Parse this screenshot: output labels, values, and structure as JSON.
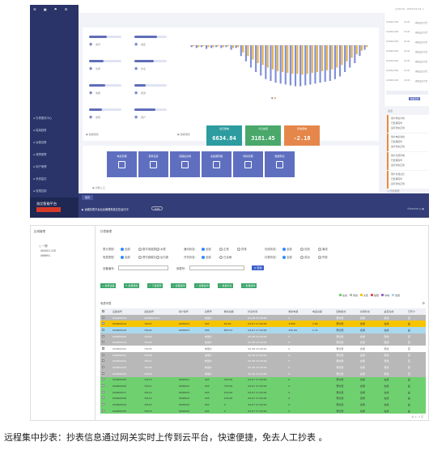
{
  "caption": "远程集中抄表：抄表信息通过网关实时上传到云平台，快速便捷，免去人工抄表 。",
  "top": {
    "header_right": "◷ 09:23 · 2019-04-14 ▢",
    "sidebar": [
      "抄表服务中心",
      "能量趋势",
      "远程设置",
      "故障报警",
      "用户管理",
      "系统监控",
      "权限控制"
    ],
    "brand": "洛比智能平台",
    "stats": [
      {
        "label": "通讯",
        "level": 0.55
      },
      {
        "label": "电压",
        "level": 0.7
      },
      {
        "label": "功率",
        "level": 0.45
      },
      {
        "label": "抄表",
        "level": 0.6
      },
      {
        "label": "电量",
        "level": 0.5
      },
      {
        "label": "费用",
        "level": 0.35
      },
      {
        "label": "告警",
        "level": 0.4
      },
      {
        "label": "用户",
        "level": 0.65
      }
    ],
    "stats_link": "数据报告",
    "chart_link": "数据报告",
    "meters": [
      {
        "title": "当日用电",
        "value": "6634.84",
        "color": "#2d9ca0"
      },
      {
        "title": "今日充值",
        "value": "3181.45",
        "color": "#4aa86b"
      },
      {
        "title": "异常用电",
        "value": "-2.18",
        "color": "#e5874a"
      }
    ],
    "chart_data": {
      "type": "bar",
      "categories": [
        "1",
        "2",
        "3",
        "4",
        "5",
        "6",
        "7",
        "8",
        "9",
        "10",
        "11",
        "12",
        "13",
        "14",
        "15",
        "16",
        "17",
        "18",
        "19",
        "20",
        "21",
        "22",
        "23",
        "24",
        "25",
        "26",
        "27",
        "28",
        "29",
        "30",
        "31",
        "32",
        "33",
        "34",
        "35",
        "36"
      ],
      "series": [
        {
          "values": [
            -2,
            -3,
            -2,
            -4,
            -3,
            -2,
            -3,
            -2,
            -5,
            -3,
            -12,
            -18,
            -25,
            -30,
            -34,
            -38,
            -40,
            -42,
            -43,
            -44,
            -45,
            -46,
            -46,
            -45,
            -44,
            -43,
            -42,
            -41,
            -40,
            -38,
            -35,
            -30,
            -25,
            -20,
            -12,
            -5
          ]
        },
        {
          "values": [
            -1,
            -2,
            -1,
            -2,
            -2,
            -1,
            -2,
            -1,
            -3,
            -2,
            -8,
            -12,
            -16,
            -20,
            -22,
            -25,
            -27,
            -29,
            -30,
            -31,
            -32,
            -32,
            -33,
            -32,
            -31,
            -30,
            -29,
            -28,
            -27,
            -25,
            -22,
            -18,
            -14,
            -10,
            -6,
            -2
          ]
        }
      ],
      "colors": [
        "#7f8fd8",
        "#e8b34a"
      ]
    },
    "side_table": [
      [
        "0.000/0.000",
        "01:00",
        "阈值设定",
        "告警"
      ],
      [
        "0.000/0.000",
        "01:00",
        "阈值设定",
        "告警"
      ],
      [
        "0.000/0.000",
        "01:00",
        "阈值设定",
        "告警"
      ],
      [
        "0.000/0.000",
        "01:00",
        "阈值设定",
        "告警"
      ],
      [
        "0.000/0.000",
        "01:00",
        "阈值设定",
        "告警"
      ],
      [
        "0.000/0.000",
        "01:00",
        "阈值设定",
        "告警"
      ],
      [
        "0.000/0.000",
        "01:00",
        "阈值设定",
        "告警"
      ]
    ],
    "side_links": [
      "数据监测",
      "设置"
    ],
    "notes": [
      [
        "用户地址异常",
        "已处理完毕",
        "运行状态正常"
      ],
      [
        "用户电表离线",
        "已处理完毕",
        "运行状态正常"
      ],
      [
        "用户欠费停电",
        "已处理完毕",
        "运行状态正常"
      ],
      [
        "用户负载过高",
        "已处理完毕",
        "运行状态正常"
      ]
    ],
    "notes_link": "历史报警",
    "tiles": [
      {
        "label": "电表管理"
      },
      {
        "label": "费率设置"
      },
      {
        "label": "远程拉合闸"
      },
      {
        "label": "采集器管理"
      },
      {
        "label": "网关管理"
      },
      {
        "label": "数据导出"
      }
    ],
    "tiles_link": "功能入口",
    "tab": "首页",
    "banner_text": "▶ 远程抄表平台后台管理系统正在运行中",
    "banner_badge": "0.01",
    "banner_right": "©DSHOP ◷ ▣"
  },
  "bottom": {
    "left_title": "区域管理",
    "tree": [
      "□ 一期",
      "  064001 01E",
      "  066691"
    ],
    "filter_title": "抄表管理",
    "filters": [
      {
        "label": "表计类型:",
        "opts": [
          "全部",
          "数字电能表",
          "水表"
        ]
      },
      {
        "label": "通讯状态:",
        "opts": [
          "全部",
          "正常",
          "异常"
        ]
      },
      {
        "label": "在线状态:",
        "opts": [
          "全部",
          "在线",
          "离线"
        ]
      }
    ],
    "filters2": [
      {
        "label": "电表类型:",
        "opts": [
          "全部",
          "预付费模式",
          "后付费"
        ]
      },
      {
        "label": "开关状态:",
        "opts": [
          "全部",
          "已合闸"
        ]
      },
      {
        "label": "抄表状态:",
        "opts": [
          "全部",
          "成功",
          "失败"
        ]
      }
    ],
    "search_label1": "设备编号:",
    "search_label2": "房屋号:",
    "search_button": "Q 查询",
    "toolbar": [
      "+ 新增设备",
      "✎ 批量修改",
      "✓ 下发费率",
      "✓ 远程拉闸",
      "✓ 远程合闸",
      "✓ 批量抄表",
      "✓ 批量操作"
    ],
    "legend": [
      "在线",
      "离线",
      "欠费",
      "故障",
      "停电",
      "告警"
    ],
    "table_title": "电表列表",
    "columns": [
      "",
      "设备编号",
      "采集编号",
      "用户编号",
      "房屋号",
      "剩余金额",
      "抄表时间",
      "剩余电量",
      "电度总额",
      "控制模式",
      "合闸状态",
      "是否在线",
      "已开户"
    ],
    "rows": [
      {
        "c": "grey",
        "v": [
          "",
          "040902016",
          "A00000 01 0",
          "",
          "未用户",
          "",
          "05-28 15:00:00",
          "0",
          "",
          "预付费",
          "合闸",
          "离线",
          "否"
        ]
      },
      {
        "c": "yellow",
        "v": [
          "",
          "040902019",
          "70101",
          "0000023",
          "003",
          "64.09",
          "04-07 17:00:00",
          "3.652",
          "3.66",
          "预付费",
          "合闸",
          "在线",
          "是"
        ]
      },
      {
        "c": "blue",
        "v": [
          "",
          "040902018",
          "70102",
          "0000023",
          "005",
          "805.51",
          "04-07 17:00:00",
          "435.09",
          "2.74",
          "预付费",
          "合闸",
          "在线",
          "是"
        ]
      },
      {
        "c": "grey",
        "v": [
          "",
          "040902020",
          "70103",
          "",
          "未用户",
          "",
          "05-28 15:00:00",
          "0",
          "",
          "预付费",
          "合闸",
          "离线",
          "否"
        ]
      },
      {
        "c": "grey",
        "v": [
          "",
          "040902019",
          "70104",
          "",
          "未用户",
          "",
          "05-28 15:00:00",
          "0",
          "",
          "预付费",
          "合闸",
          "离线",
          "否"
        ]
      },
      {
        "c": "white",
        "v": [
          "",
          "040902020",
          "70105",
          "",
          "未用户",
          "",
          "05-28 15:00:00",
          "0",
          "",
          "预付费",
          "合闸",
          "离线",
          "否"
        ]
      },
      {
        "c": "grey",
        "v": [
          "",
          "040902021",
          "70106",
          "",
          "未用户",
          "",
          "05-28 15:00:00",
          "0",
          "",
          "预付费",
          "合闸",
          "离线",
          "否"
        ]
      },
      {
        "c": "grey",
        "v": [
          "",
          "040902022",
          "70107",
          "",
          "未用户",
          "",
          "05-28 15:00:00",
          "0",
          "",
          "预付费",
          "合闸",
          "离线",
          "否"
        ]
      },
      {
        "c": "grey",
        "v": [
          "",
          "040902023",
          "70108",
          "",
          "未用户",
          "",
          "05-28 15:00:00",
          "0",
          "",
          "预付费",
          "合闸",
          "离线",
          "否"
        ]
      },
      {
        "c": "grey",
        "v": [
          "",
          "040902024",
          "70109",
          "",
          "未用户",
          "",
          "05-28 15:00:00",
          "0",
          "",
          "预付费",
          "合闸",
          "离线",
          "否"
        ]
      },
      {
        "c": "green",
        "v": [
          "",
          "040902025",
          "70110",
          "0000021",
          "003",
          "393.00",
          "04-07 17:00:00",
          "0",
          "",
          "预付费",
          "合闸",
          "在线",
          "是"
        ]
      },
      {
        "c": "green",
        "v": [
          "",
          "040902026",
          "70111",
          "0000022",
          "003",
          "730.00",
          "04-07 17:00:00",
          "0",
          "",
          "预付费",
          "合闸",
          "在线",
          "是"
        ]
      },
      {
        "c": "green",
        "v": [
          "",
          "040902027",
          "70112",
          "0000023",
          "003",
          "100.00",
          "04-07 17:00:00",
          "0",
          "",
          "预付费",
          "合闸",
          "在线",
          "是"
        ]
      },
      {
        "c": "green",
        "v": [
          "",
          "040902028",
          "70113",
          "0000024",
          "003",
          "100.00",
          "04-07 17:00:00",
          "0",
          "",
          "预付费",
          "合闸",
          "在线",
          "是"
        ]
      },
      {
        "c": "green",
        "v": [
          "",
          "040902029",
          "70114",
          "0000025",
          "003",
          "0",
          "04-07 17:00:00",
          "0",
          "",
          "预付费",
          "合闸",
          "在线",
          "是"
        ]
      },
      {
        "c": "green",
        "v": [
          "",
          "040902030",
          "70115",
          "0000026",
          "003",
          "0",
          "04-07 17:00:00",
          "0",
          "",
          "预付费",
          "合闸",
          "在线",
          "是"
        ]
      }
    ],
    "footer": "共 1 / 3 页"
  }
}
